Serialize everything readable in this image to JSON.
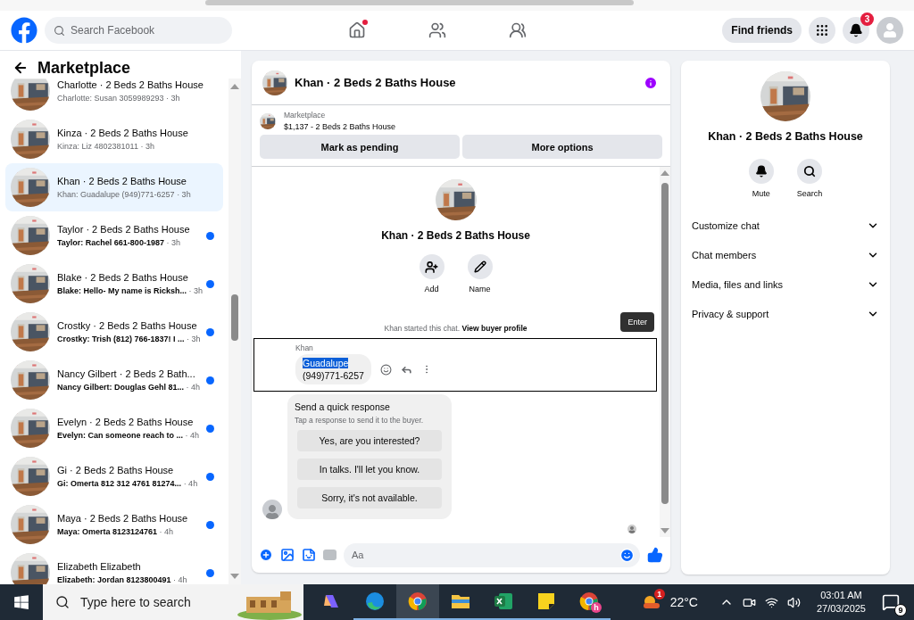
{
  "header": {
    "search": {
      "placeholder": "Search Facebook"
    },
    "nav": [
      {
        "kind": "home",
        "notify": true
      },
      {
        "kind": "friends",
        "notify": false
      },
      {
        "kind": "groups",
        "notify": false
      }
    ],
    "find_friends": "Find friends",
    "notifications_badge": "3"
  },
  "sidebar": {
    "title": "Marketplace",
    "items": [
      {
        "title": "Charlotte · 2 Beds 2 Baths House",
        "message": "Charlotte: Susan 3059989293",
        "time": "· 3h",
        "unread": false,
        "selected": false
      },
      {
        "title": "Kinza · 2 Beds 2 Baths House",
        "message": "Kinza: Liz 4802381011",
        "time": "· 3h",
        "unread": false,
        "selected": false
      },
      {
        "title": "Khan · 2 Beds 2 Baths House",
        "message": "Khan: Guadalupe (949)771-6257",
        "time": "· 3h",
        "unread": false,
        "selected": true
      },
      {
        "title": "Taylor · 2 Beds 2 Baths House",
        "message": "Taylor: Rachel 661-800-1987",
        "time": "· 3h",
        "unread": true,
        "selected": false
      },
      {
        "title": "Blake · 2 Beds 2 Baths House",
        "message": "Blake: Hello- My name is Ricksh...",
        "time": "· 3h",
        "unread": true,
        "selected": false
      },
      {
        "title": "Crostky · 2 Beds 2 Baths House",
        "message": "Crostky: Trish (812) 766-1837! I ...",
        "time": "· 3h",
        "unread": true,
        "selected": false
      },
      {
        "title": "Nancy Gilbert · 2 Beds 2 Bath...",
        "message": "Nancy Gilbert: Douglas Gehl 81...",
        "time": "· 4h",
        "unread": true,
        "selected": false
      },
      {
        "title": "Evelyn · 2 Beds 2 Baths House",
        "message": "Evelyn: Can someone reach to ...",
        "time": "· 4h",
        "unread": true,
        "selected": false
      },
      {
        "title": "Gi · 2 Beds 2 Baths House",
        "message": "Gi: Omerta 812 312 4761 81274...",
        "time": "· 4h",
        "unread": true,
        "selected": false
      },
      {
        "title": "Maya · 2 Beds 2 Baths House",
        "message": "Maya: Omerta 8123124761",
        "time": "· 4h",
        "unread": true,
        "selected": false
      },
      {
        "title": "Elizabeth Elizabeth",
        "message": "Elizabeth: Jordan 8123800491",
        "time": "· 4h",
        "unread": true,
        "selected": false
      }
    ]
  },
  "chat": {
    "title": "Khan · 2 Beds 2 Baths House",
    "listing": {
      "source": "Marketplace",
      "summary": "$1,137 - 2 Beds 2 Baths House"
    },
    "actions": [
      "Mark as pending",
      "More options"
    ],
    "intro": {
      "title": "Khan · 2 Beds 2 Baths House",
      "buttons": [
        {
          "kind": "add",
          "label": "Add"
        },
        {
          "kind": "name",
          "label": "Name"
        }
      ],
      "started": "Khan started this chat.",
      "link": "View buyer profile"
    },
    "tooltip": "Enter",
    "message": {
      "sender": "Khan",
      "lines": [
        {
          "text": "Guadalupe",
          "selected": true
        },
        {
          "text": "(949)771-6257",
          "selected": false
        }
      ]
    },
    "quick": {
      "title": "Send a quick response",
      "hint": "Tap a response to send it to the buyer.",
      "options": [
        "Yes, are you interested?",
        "In talks. I'll let you know.",
        "Sorry, it's not available."
      ]
    },
    "composer": {
      "placeholder": "Aa"
    }
  },
  "details": {
    "title": "Khan · 2 Beds 2 Baths House",
    "actions": [
      {
        "kind": "mute",
        "label": "Mute"
      },
      {
        "kind": "search",
        "label": "Search"
      }
    ],
    "sections": [
      "Customize chat",
      "Chat members",
      "Media, files and links",
      "Privacy & support"
    ]
  },
  "taskbar": {
    "search": {
      "placeholder": "Type here to search"
    },
    "apps": [
      {
        "kind": "copilot",
        "selected": false,
        "open": false
      },
      {
        "kind": "edge",
        "selected": false,
        "open": true
      },
      {
        "kind": "chrome",
        "selected": true,
        "open": true
      },
      {
        "kind": "explorer",
        "selected": false,
        "open": true
      },
      {
        "kind": "excel",
        "selected": false,
        "open": true
      },
      {
        "kind": "notes",
        "selected": false,
        "open": true
      },
      {
        "kind": "chrome-profile",
        "selected": false,
        "open": true,
        "profile": "h"
      }
    ],
    "weather": {
      "badge": "1",
      "temp": "22°C"
    },
    "time": "03:01 AM",
    "date": "27/03/2025",
    "notifications": "9"
  }
}
